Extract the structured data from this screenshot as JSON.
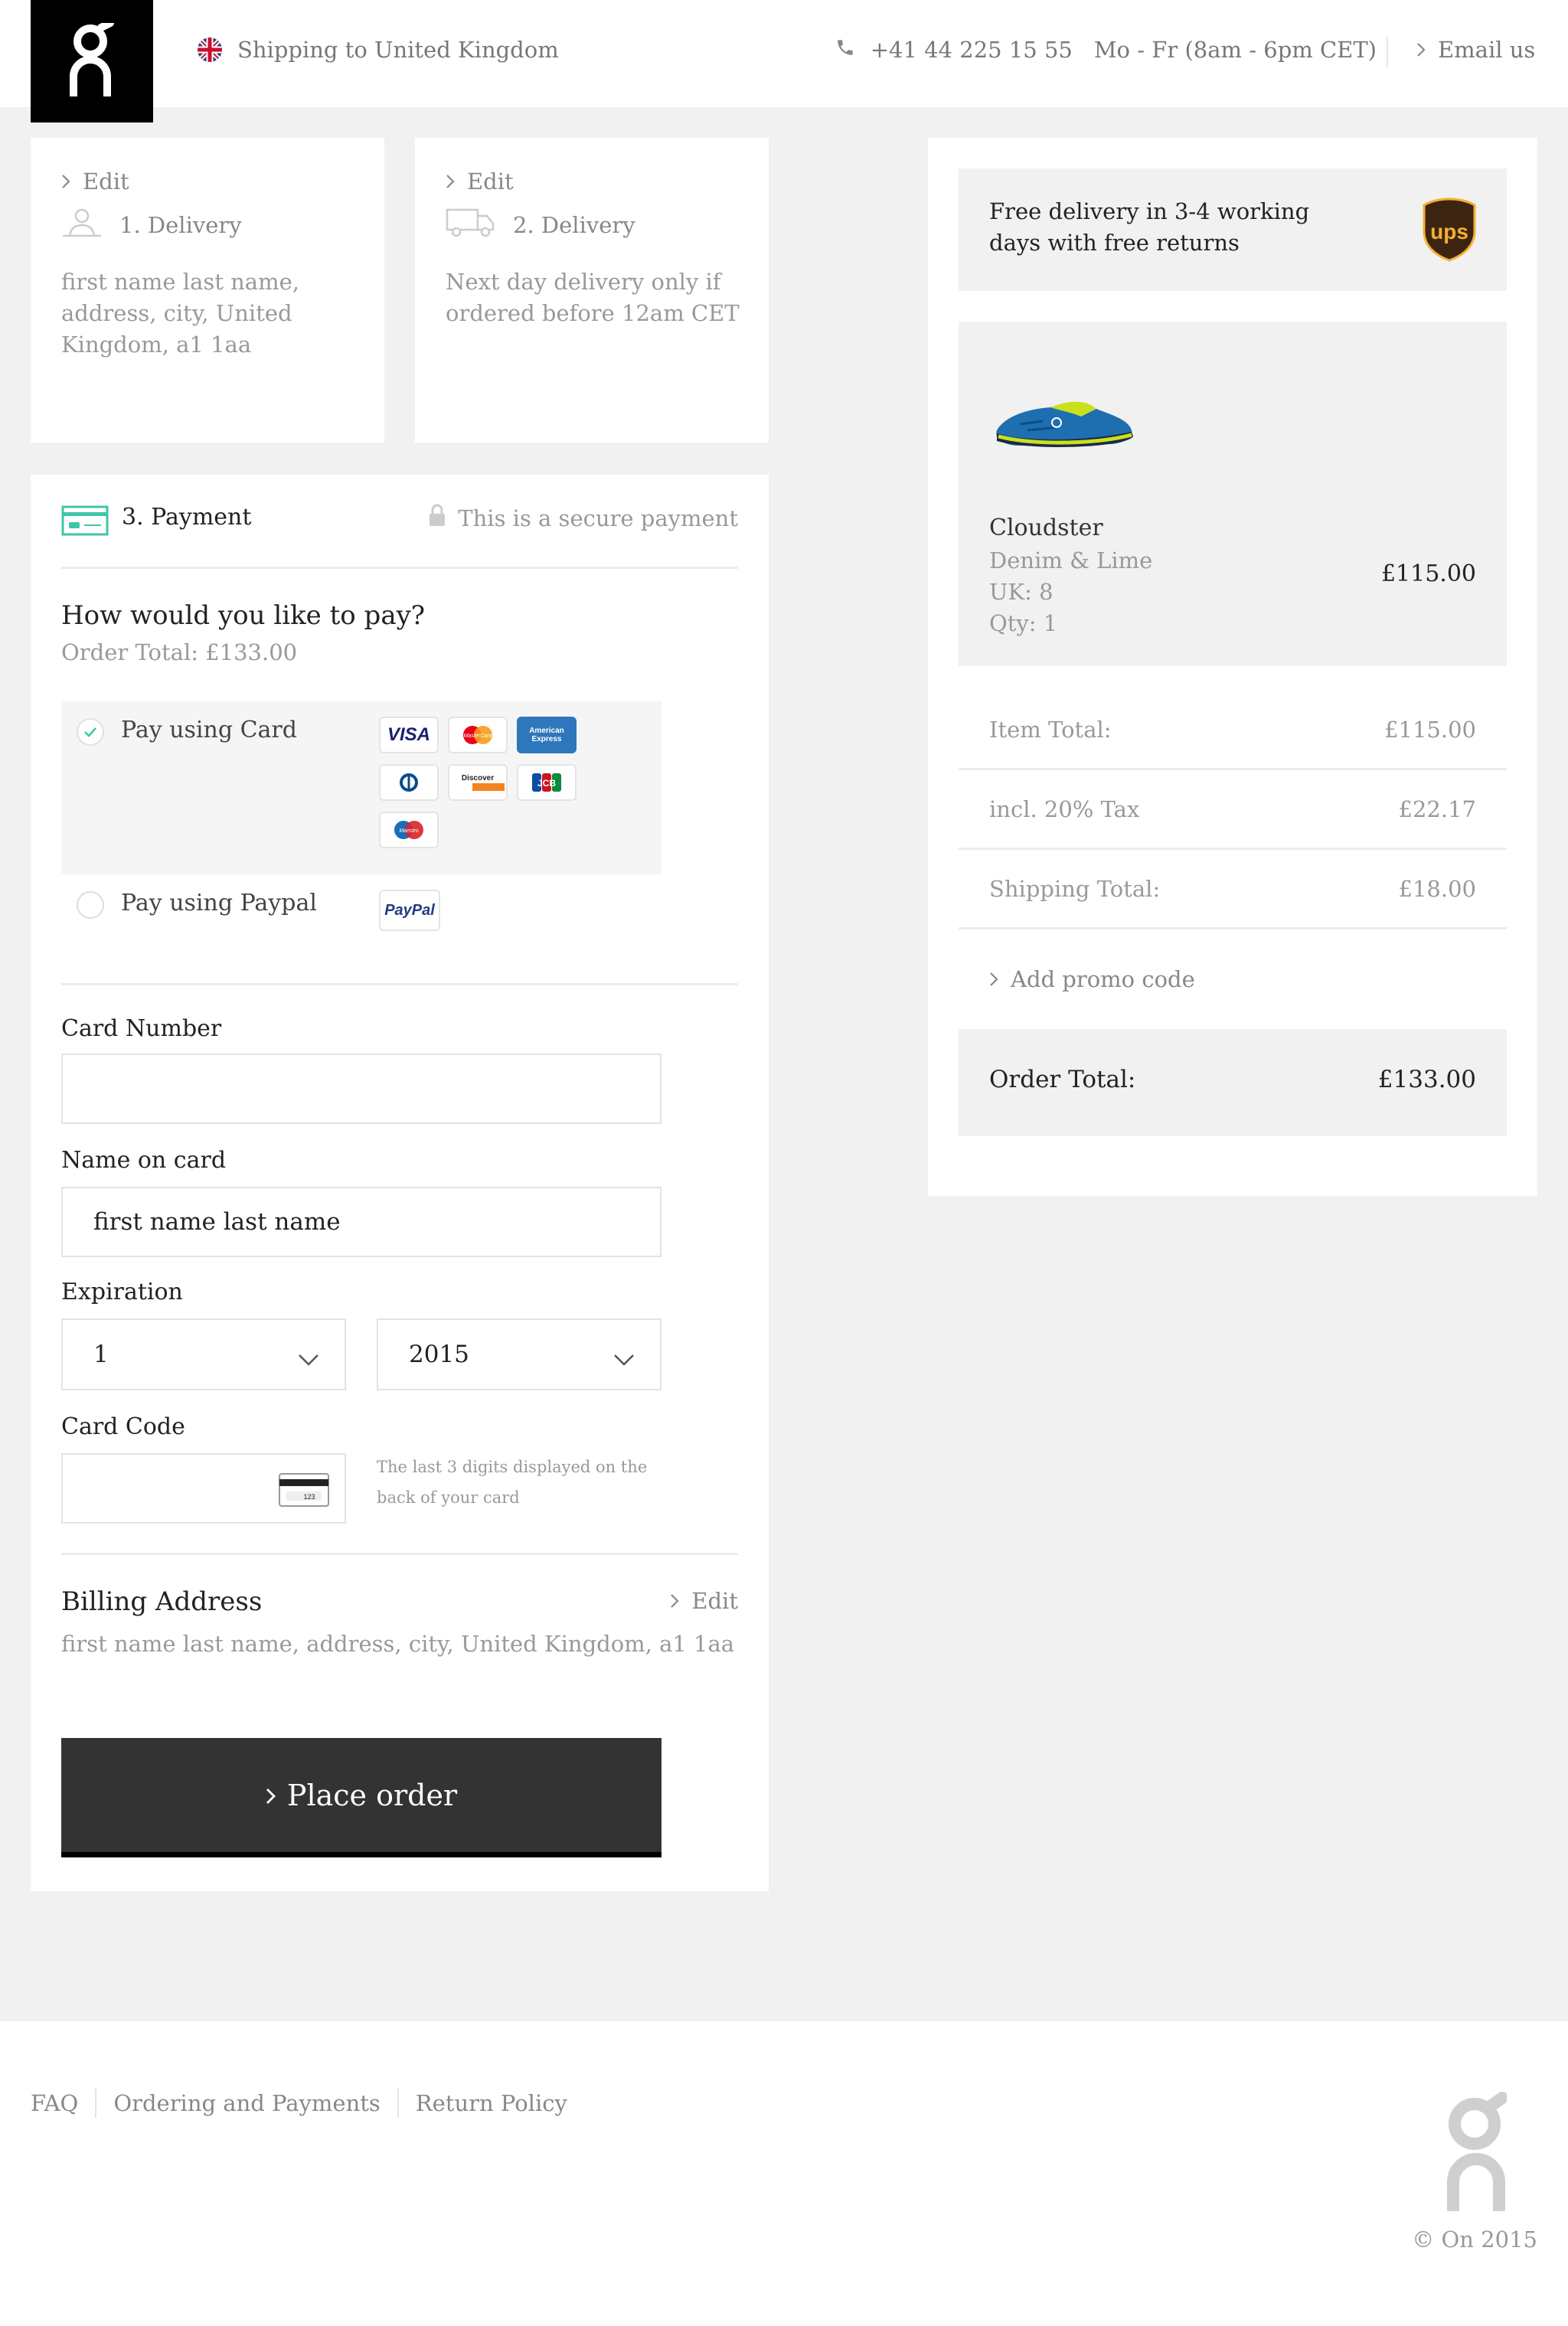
{
  "header": {
    "shipping": "Shipping to United Kingdom",
    "phone": "+41 44 225 15 55",
    "hours": "Mo - Fr (8am - 6pm CET)",
    "email": "Email us"
  },
  "delivery1": {
    "edit": "Edit",
    "step": "1. Delivery",
    "address": "first name last name, address, city, United Kingdom, a1 1aa"
  },
  "delivery2": {
    "edit": "Edit",
    "step": "2. Delivery",
    "note": "Next day delivery only if ordered before 12am CET"
  },
  "payment": {
    "step": "3. Payment",
    "secure": "This is a secure payment",
    "question": "How would you like to pay?",
    "order_total": "Order Total: £133.00",
    "option_card": "Pay using Card",
    "option_paypal": "Pay using Paypal",
    "card_logos": [
      "VISA",
      "MasterCard",
      "American Express",
      "Diners Club",
      "Discover",
      "JCB",
      "Maestro"
    ],
    "paypal_logo": "PayPal",
    "selected_option": "card"
  },
  "form": {
    "card_number_label": "Card Number",
    "card_number_value": "",
    "name_label": "Name on card",
    "name_value": "first name last name",
    "expiration_label": "Expiration",
    "exp_month": "1",
    "exp_year": "2015",
    "card_code_label": "Card Code",
    "card_code_value": "",
    "card_code_hint": "The last 3 digits displayed on the back of your card",
    "card_code_icon_digits": "123"
  },
  "billing": {
    "title": "Billing Address",
    "edit": "Edit",
    "address": "first name last name, address, city, United Kingdom, a1 1aa"
  },
  "place_order": "Place order",
  "summary": {
    "delivery_note": "Free delivery in 3-4 working days with free returns",
    "carrier_logo": "ups",
    "product": {
      "name": "Cloudster",
      "color": "Denim & Lime",
      "size": "UK: 8",
      "qty": "Qty: 1",
      "price": "£115.00"
    },
    "rows": [
      {
        "label": "Item Total:",
        "value": "£115.00"
      },
      {
        "label": "incl. 20% Tax",
        "value": "£22.17"
      },
      {
        "label": "Shipping Total:",
        "value": "£18.00"
      }
    ],
    "promo": "Add promo code",
    "total_label": "Order Total:",
    "total_value": "£133.00"
  },
  "footer": {
    "links": [
      "FAQ",
      "Ordering and Payments",
      "Return Policy"
    ],
    "copyright": "© On 2015"
  },
  "colors": {
    "accent": "#3ec6a8",
    "button": "#333333",
    "background": "#f1f1f1",
    "ups_brown": "#3d2411",
    "ups_gold": "#f2b02f"
  }
}
